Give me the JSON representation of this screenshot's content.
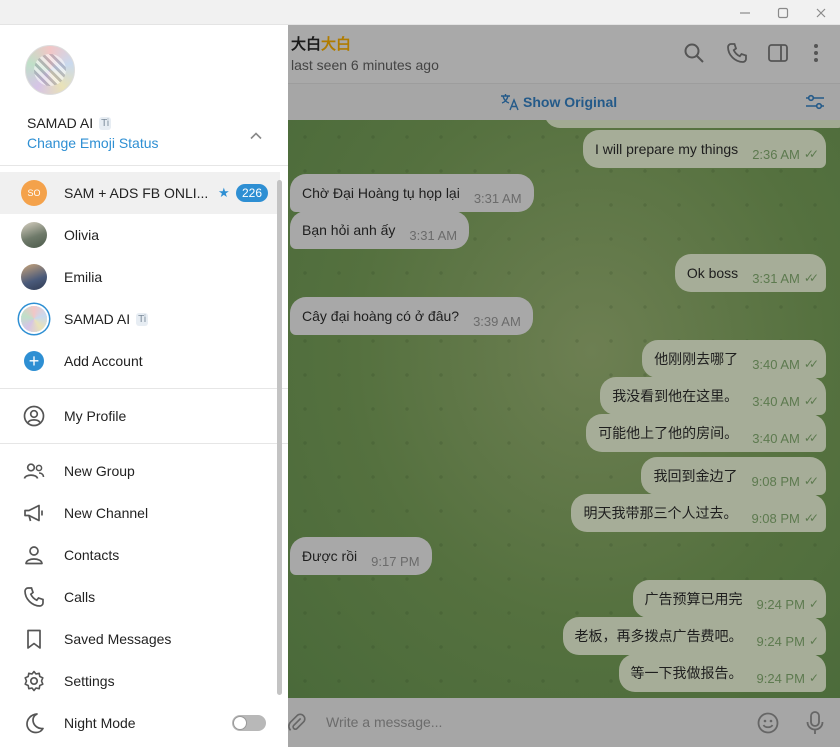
{
  "window": {
    "minimize": "–",
    "maximize": "▢",
    "close": "✕"
  },
  "drawer": {
    "profile_name": "SAMAD AI",
    "emoji_status_link": "Change Emoji Status",
    "accounts": [
      {
        "label": "SAM + ADS FB ONLI...",
        "initials": "SO",
        "unread": "226",
        "pinned": true
      },
      {
        "label": "Olivia"
      },
      {
        "label": "Emilia"
      },
      {
        "label": "SAMAD AI"
      }
    ],
    "add_account": "Add Account",
    "menu": {
      "my_profile": "My Profile",
      "new_group": "New Group",
      "new_channel": "New Channel",
      "contacts": "Contacts",
      "calls": "Calls",
      "saved_messages": "Saved Messages",
      "settings": "Settings",
      "night_mode": "Night Mode"
    },
    "night_mode_on": false
  },
  "chat": {
    "peer_name_plain": "大白",
    "peer_name_accent": "大白",
    "peer_status": "last seen 6 minutes ago",
    "translate_label": "Show Original",
    "messages": [
      {
        "dir": "out",
        "text": "I will prepare my things",
        "time": "2:36 AM",
        "read": true
      },
      {
        "dir": "in",
        "text": "Chờ Đại Hoàng tụ họp lại",
        "time": "3:31 AM"
      },
      {
        "dir": "in",
        "text": "Bạn hỏi anh ấy",
        "time": "3:31 AM"
      },
      {
        "dir": "out",
        "text": "Ok boss",
        "time": "3:31 AM",
        "read": true
      },
      {
        "dir": "in",
        "text": "Cây đại hoàng có ở đâu?",
        "time": "3:39 AM"
      },
      {
        "dir": "out",
        "text": "他刚刚去哪了",
        "time": "3:40 AM",
        "read": true
      },
      {
        "dir": "out",
        "text": "我没看到他在这里。",
        "time": "3:40 AM",
        "read": true
      },
      {
        "dir": "out",
        "text": "可能他上了他的房间。",
        "time": "3:40 AM",
        "read": true
      },
      {
        "dir": "out",
        "text": "我回到金边了",
        "time": "9:08 PM",
        "read": true
      },
      {
        "dir": "out",
        "text": "明天我带那三个人过去。",
        "time": "9:08 PM",
        "read": true
      },
      {
        "dir": "in",
        "text": "Được rồi",
        "time": "9:17 PM"
      },
      {
        "dir": "out",
        "text": "广告预算已用完",
        "time": "9:24 PM",
        "read": false
      },
      {
        "dir": "out",
        "text": "老板，再多拨点广告费吧。",
        "time": "9:24 PM",
        "read": false
      },
      {
        "dir": "out",
        "text": "等一下我做报告。",
        "time": "9:24 PM",
        "read": false
      }
    ],
    "composer_placeholder": "Write a message..."
  }
}
